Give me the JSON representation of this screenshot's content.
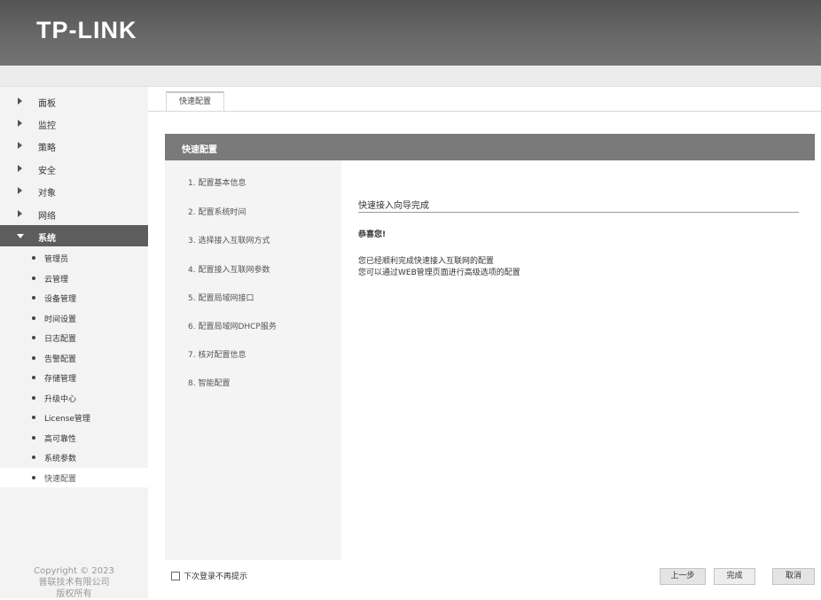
{
  "header": {
    "logo": "TP-LINK"
  },
  "sidebar": {
    "items": [
      {
        "label": "面板"
      },
      {
        "label": "监控"
      },
      {
        "label": "策略"
      },
      {
        "label": "安全"
      },
      {
        "label": "对象"
      },
      {
        "label": "网络"
      },
      {
        "label": "系统"
      }
    ],
    "active_index": 6,
    "sub_items": [
      {
        "label": "管理员"
      },
      {
        "label": "云管理"
      },
      {
        "label": "设备管理"
      },
      {
        "label": "时间设置"
      },
      {
        "label": "日志配置"
      },
      {
        "label": "告警配置"
      },
      {
        "label": "存储管理"
      },
      {
        "label": "升级中心"
      },
      {
        "label": "License管理"
      },
      {
        "label": "高可靠性"
      },
      {
        "label": "系统参数"
      },
      {
        "label": "快速配置"
      }
    ],
    "selected_sub_index": 11,
    "copyright": {
      "line1": "Copyright © 2023",
      "line2": "普联技术有限公司",
      "line3": "版权所有"
    }
  },
  "tabs": [
    {
      "label": "快速配置"
    }
  ],
  "panel": {
    "title": "快速配置",
    "steps": [
      "1. 配置基本信息",
      "2. 配置系统时间",
      "3. 选择接入互联网方式",
      "4. 配置接入互联网参数",
      "5. 配置局域网接口",
      "6. 配置局域网DHCP服务",
      "7. 核对配置信息",
      "8. 智能配置"
    ],
    "result_title": "快速接入向导完成",
    "congrats": "恭喜您!",
    "message_line1": "您已经顺利完成快速接入互联网的配置",
    "message_line2": "您可以通过WEB管理页面进行高级选项的配置"
  },
  "footer": {
    "checkbox_label": "下次登录不再提示",
    "checkbox_checked": false,
    "prev_label": "上一步",
    "done_label": "完成",
    "cancel_label": "取消"
  },
  "icons": {
    "collapsed": "caret-right-icon",
    "expanded": "caret-down-icon",
    "bullet": "bullet-icon",
    "checkbox": "checkbox-icon"
  }
}
